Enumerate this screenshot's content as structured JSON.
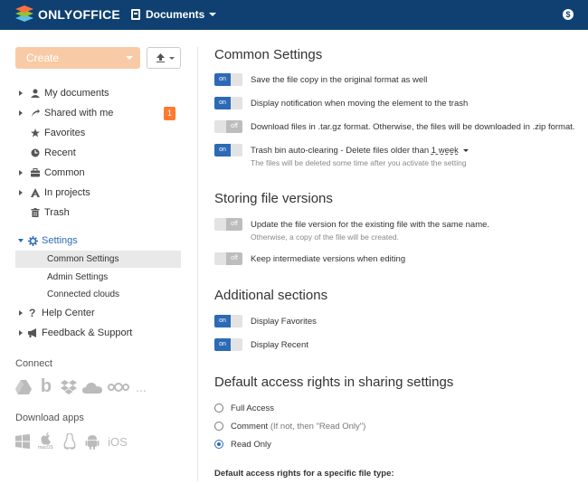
{
  "header": {
    "logo_text": "ONLYOFFICE",
    "module_label": "Documents",
    "user_icon_glyph": "$"
  },
  "sidebar": {
    "create_label": "Create",
    "nav": [
      {
        "label": "My documents",
        "icon": "user-icon"
      },
      {
        "label": "Shared with me",
        "icon": "share-icon",
        "badge": "1"
      },
      {
        "label": "Favorites",
        "icon": "star-icon"
      },
      {
        "label": "Recent",
        "icon": "clock-icon"
      },
      {
        "label": "Common",
        "icon": "briefcase-icon"
      },
      {
        "label": "In projects",
        "icon": "projects-icon"
      },
      {
        "label": "Trash",
        "icon": "trash-icon"
      }
    ],
    "settings": {
      "label": "Settings",
      "items": [
        "Common Settings",
        "Admin Settings",
        "Connected clouds"
      ]
    },
    "help_label": "Help Center",
    "feedback_label": "Feedback & Support",
    "connect_label": "Connect",
    "connect_more": "...",
    "download_label": "Download apps",
    "ios_label": "iOS",
    "macos_label": "macOS"
  },
  "main": {
    "common_settings": {
      "title": "Common Settings",
      "options": [
        {
          "state": "on",
          "text": "Save the file copy in the original format as well"
        },
        {
          "state": "on",
          "text": "Display notification when moving the element to the trash"
        },
        {
          "state": "off",
          "text": "Download files in .tar.gz format. Otherwise, the files will be downloaded in .zip format."
        }
      ],
      "trash": {
        "state": "on",
        "text": "Trash bin auto-clearing - Delete files older than",
        "value": "1 week",
        "hint": "The files will be deleted some time after you activate the setting"
      }
    },
    "versions": {
      "title": "Storing file versions",
      "options": [
        {
          "state": "off",
          "text": "Update the file version for the existing file with the same name.",
          "hint": "Otherwise, a copy of the file will be created."
        },
        {
          "state": "off",
          "text": "Keep intermediate versions when editing"
        }
      ]
    },
    "additional": {
      "title": "Additional sections",
      "options": [
        {
          "state": "on",
          "text": "Display Favorites"
        },
        {
          "state": "on",
          "text": "Display Recent"
        }
      ]
    },
    "access": {
      "title": "Default access rights in sharing settings",
      "radios": [
        {
          "label": "Full Access",
          "note": "",
          "checked": false
        },
        {
          "label": "Comment",
          "note": "(If not, then \"Read Only\")",
          "checked": false
        },
        {
          "label": "Read Only",
          "note": "",
          "checked": true
        }
      ],
      "file_type_label": "Default access rights for a specific file type:"
    },
    "toggle_on_label": "on",
    "toggle_off_label": "off"
  }
}
